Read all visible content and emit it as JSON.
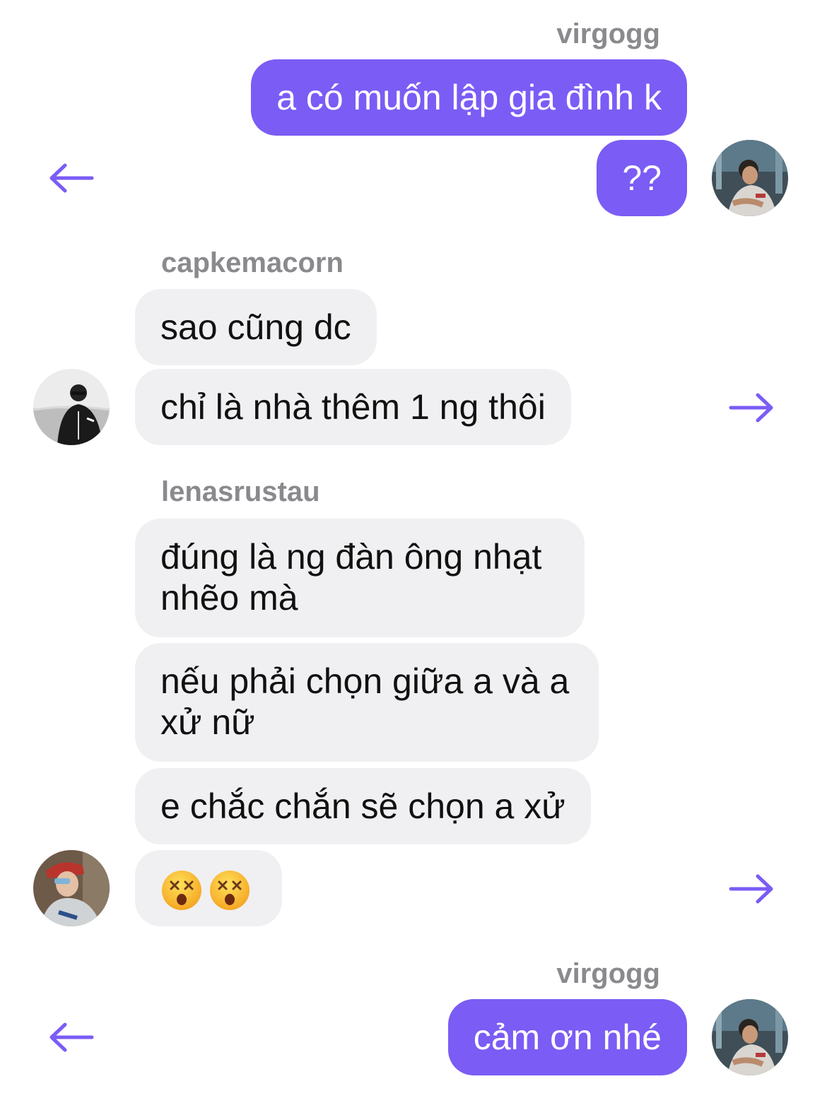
{
  "colors": {
    "accent": "#7b5cf5",
    "incoming_bubble": "#f0f0f2",
    "username": "#8a8a8e"
  },
  "groups": [
    {
      "sender": "virgogg",
      "side": "outgoing",
      "messages": [
        "a có muốn lập gia đình k",
        "??"
      ],
      "action_icon": "arrow-left-icon"
    },
    {
      "sender": "capkemacorn",
      "side": "incoming",
      "messages": [
        "sao cũng dc",
        "chỉ là nhà thêm 1 ng thôi"
      ],
      "action_icon": "arrow-right-icon"
    },
    {
      "sender": "lenasrustau",
      "side": "incoming",
      "messages": [
        "đúng là ng đàn ông nhạt nhẽo mà",
        "nếu phải chọn giữa a và a xử nữ",
        "e chắc chắn sẽ chọn a xử",
        "😵😵"
      ],
      "emoji_names": [
        "dizzy-face-emoji",
        "dizzy-face-emoji"
      ],
      "action_icon": "arrow-right-icon"
    },
    {
      "sender": "virgogg",
      "side": "outgoing",
      "messages": [
        "cảm ơn nhé"
      ],
      "action_icon": "arrow-left-icon"
    }
  ]
}
